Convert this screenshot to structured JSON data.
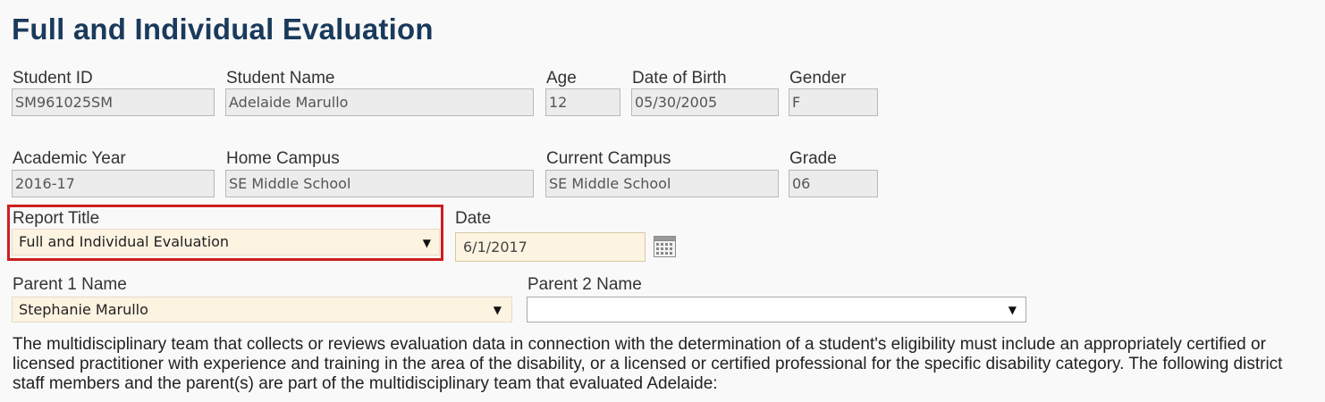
{
  "page": {
    "title": "Full and Individual Evaluation"
  },
  "student": {
    "id_label": "Student ID",
    "id_value": "SM961025SM",
    "name_label": "Student Name",
    "name_value": "Adelaide Marullo",
    "age_label": "Age",
    "age_value": "12",
    "dob_label": "Date of Birth",
    "dob_value": "05/30/2005",
    "gender_label": "Gender",
    "gender_value": "F"
  },
  "enrollment": {
    "year_label": "Academic Year",
    "year_value": "2016-17",
    "home_label": "Home Campus",
    "home_value": "SE Middle School",
    "current_label": "Current Campus",
    "current_value": "SE Middle School",
    "grade_label": "Grade",
    "grade_value": "06"
  },
  "report": {
    "title_label": "Report Title",
    "title_selected": "Full and Individual Evaluation",
    "date_label": "Date",
    "date_value": "6/1/2017"
  },
  "parents": {
    "parent1_label": "Parent 1 Name",
    "parent1_selected": "Stephanie Marullo",
    "parent2_label": "Parent 2 Name",
    "parent2_selected": ""
  },
  "description": "The multidisciplinary team that collects or reviews evaluation data in connection with the determination of a student's eligibility must include an appropriately certified or licensed practitioner with experience and training in the area of the disability, or a licensed or certified professional for the specific disability category. The following district staff members and the parent(s) are part of the multidisciplinary team that evaluated Adelaide:",
  "icons": {
    "dropdown": "triangle-down-icon",
    "calendar": "calendar-icon"
  },
  "colors": {
    "title": "#1a3a5c",
    "highlight_border": "#cc1f1f",
    "editable_bg": "#fdf3e1",
    "readonly_bg": "#ececec"
  }
}
